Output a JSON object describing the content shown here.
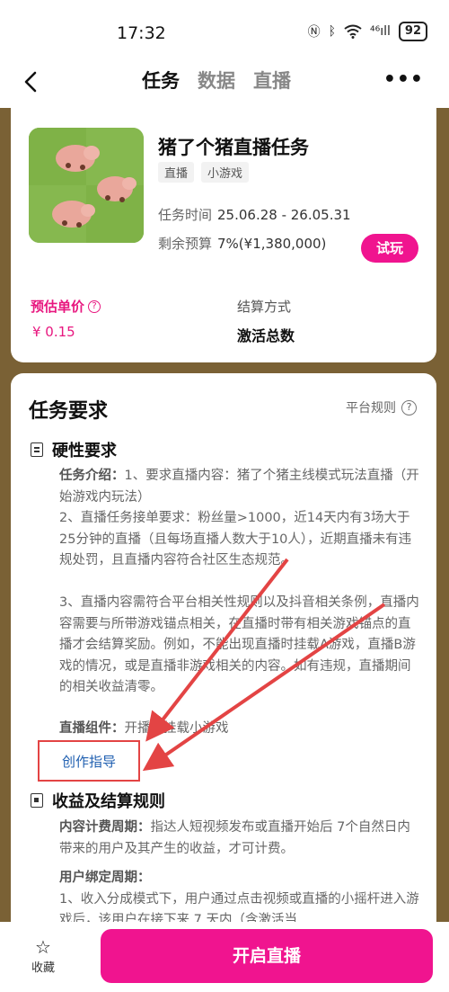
{
  "status_bar": {
    "time": "17:32",
    "battery": "92",
    "signal_text": "⁴⁶ıll"
  },
  "nav": {
    "tabs": [
      {
        "label": "任务"
      },
      {
        "label": "数据"
      },
      {
        "label": "直播"
      }
    ],
    "more": "•••"
  },
  "task": {
    "title": "猪了个猪直播任务",
    "tags": [
      "直播",
      "小游戏"
    ],
    "period_label": "任务时间",
    "period_value": "25.06.28 - 26.05.31",
    "budget_label": "剩余预算",
    "budget_value": "7%(¥1,380,000)",
    "try_label": "试玩",
    "price_label": "预估单价",
    "price_value": "¥ 0.15",
    "settle_label": "结算方式",
    "settle_value": "激活总数"
  },
  "requirements": {
    "title": "任务要求",
    "rules_link": "平台规则",
    "hard": {
      "heading": "硬性要求",
      "intro_key": "任务介绍：",
      "intro_text": "1、要求直播内容：猪了个猪主线模式玩法直播（开始游戏内玩法）",
      "item2": "2、直播任务接单要求：粉丝量>1000，近14天内有3场大于25分钟的直播（且每场直播人数大于10人），近期直播未有违规处罚，且直播内容符合社区生态规范。",
      "item3": "3、直播内容需符合平台相关性规则以及抖音相关条例，直播内容需要与所带游戏锚点相关，在直播时带有相关游戏锚点的直播才会结算奖励。例如，不能出现直播时挂载A游戏，直播B游戏的情况，或是直播非游戏相关的内容。如有违规，直播期间的相关收益清零。",
      "component_key": "直播组件：",
      "component_text": "开播时挂载小游戏",
      "guide_label": "创作指导"
    },
    "revenue": {
      "heading": "收益及结算规则",
      "period_key": "内容计费周期：",
      "period_text": "指达人短视频发布或直播开始后 7个自然日内 带来的用户及其产生的收益，才可计费。",
      "bind_key": "用户绑定周期：",
      "bind_text": "1、收入分成模式下，用户通过点击视频或直播的小摇杆进入游戏后，该用户在接下来 7 天内（含激活当"
    }
  },
  "bottom": {
    "fav_label": "收藏",
    "live_label": "开启直播"
  },
  "colors": {
    "accent": "#f0148f",
    "background": "#7a6135",
    "annotation": "#e34444"
  }
}
